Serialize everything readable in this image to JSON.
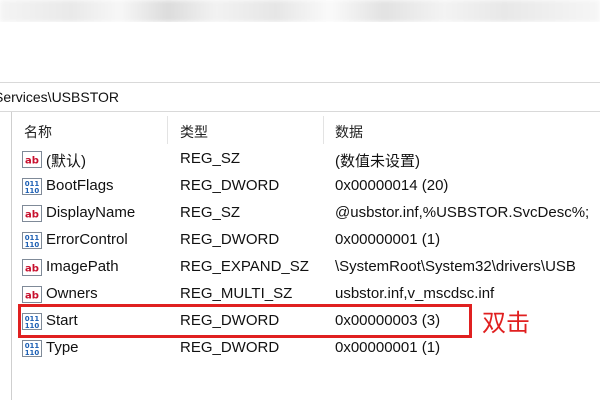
{
  "address_path": "Services\\USBSTOR",
  "columns": {
    "name": "名称",
    "type": "类型",
    "data": "数据"
  },
  "rows": [
    {
      "icon": "string-value-icon",
      "name": "(默认)",
      "type": "REG_SZ",
      "data": "(数值未设置)"
    },
    {
      "icon": "binary-value-icon",
      "name": "BootFlags",
      "type": "REG_DWORD",
      "data": "0x00000014 (20)"
    },
    {
      "icon": "string-value-icon",
      "name": "DisplayName",
      "type": "REG_SZ",
      "data": "@usbstor.inf,%USBSTOR.SvcDesc%;"
    },
    {
      "icon": "binary-value-icon",
      "name": "ErrorControl",
      "type": "REG_DWORD",
      "data": "0x00000001 (1)"
    },
    {
      "icon": "string-value-icon",
      "name": "ImagePath",
      "type": "REG_EXPAND_SZ",
      "data": "\\SystemRoot\\System32\\drivers\\USB"
    },
    {
      "icon": "string-value-icon",
      "name": "Owners",
      "type": "REG_MULTI_SZ",
      "data": "usbstor.inf,v_mscdsc.inf"
    },
    {
      "icon": "binary-value-icon",
      "name": "Start",
      "type": "REG_DWORD",
      "data": "0x00000003 (3)"
    },
    {
      "icon": "binary-value-icon",
      "name": "Type",
      "type": "REG_DWORD",
      "data": "0x00000001 (1)"
    }
  ],
  "annotation": "双击",
  "colors": {
    "highlight": "#e02020",
    "string_icon": "#c8102e",
    "binary_icon": "#1c5fb4"
  }
}
